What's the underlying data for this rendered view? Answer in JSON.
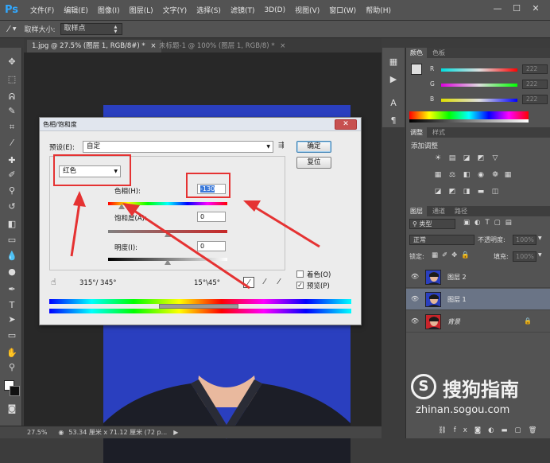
{
  "app": {
    "logo": "Ps",
    "menu": [
      "文件(F)",
      "编辑(E)",
      "图像(I)",
      "图层(L)",
      "文字(Y)",
      "选择(S)",
      "滤镜(T)",
      "3D(D)",
      "视图(V)",
      "窗口(W)",
      "帮助(H)"
    ],
    "window_controls": [
      "—",
      "☐",
      "✕"
    ]
  },
  "options_bar": {
    "tool_icon": "eyedropper-icon",
    "sample_size_label": "取样大小:",
    "sample_size_value": "取样点"
  },
  "document_tabs": [
    {
      "label": "1.jpg @ 27.5% (图层 1, RGB/8#) *",
      "close": "×"
    },
    {
      "label": "未标题-1 @ 100% (图层 1, RGB/8) *",
      "close": "×"
    }
  ],
  "status_bar": {
    "zoom": "27.5%",
    "doc_info": "53.34 厘米 x 71.12 厘米 (72 p..."
  },
  "color_panel": {
    "tabs": [
      "颜色",
      "色板"
    ],
    "channels": [
      {
        "letter": "R",
        "value": "222"
      },
      {
        "letter": "G",
        "value": "222"
      },
      {
        "letter": "B",
        "value": "222"
      }
    ]
  },
  "adjustments_panel": {
    "tabs": [
      "调整",
      "样式"
    ],
    "add_label": "添加调整"
  },
  "layers_panel": {
    "tabs": [
      "图层",
      "通道",
      "路径"
    ],
    "filter_label": "类型",
    "blend_mode": "正常",
    "opacity_label": "不透明度:",
    "opacity_value": "100%",
    "lock_label": "锁定:",
    "fill_label": "填充:",
    "fill_value": "100%",
    "layers": [
      {
        "name": "图层 2",
        "selected": false,
        "locked": false
      },
      {
        "name": "图层 1",
        "selected": true,
        "locked": false
      },
      {
        "name": "背景",
        "selected": false,
        "locked": true
      }
    ],
    "footer_icons": [
      "link-icon",
      "fx-icon",
      "mask-icon",
      "adjustment-icon",
      "folder-icon",
      "new-layer-icon",
      "trash-icon"
    ]
  },
  "dialog": {
    "title": "色相/饱和度",
    "preset_label": "预设(E):",
    "preset_value": "自定",
    "channel_value": "红色",
    "hue_label": "色相(H):",
    "hue_value": "-130",
    "saturation_label": "饱和度(A):",
    "saturation_value": "0",
    "lightness_label": "明度(I):",
    "lightness_value": "0",
    "range_left": "315°/ 345°",
    "range_right": "15°\\45°",
    "colorize_label": "着色(O)",
    "preview_label": "预览(P)",
    "colorize_checked": false,
    "preview_checked": true,
    "ok_label": "确定",
    "reset_label": "复位",
    "close_glyph": "✕",
    "hue_fraction": 0.11,
    "saturation_fraction": 0.5,
    "lightness_fraction": 0.5
  },
  "watermark": {
    "brand": "搜狗指南",
    "url": "zhinan.sogou.com"
  }
}
